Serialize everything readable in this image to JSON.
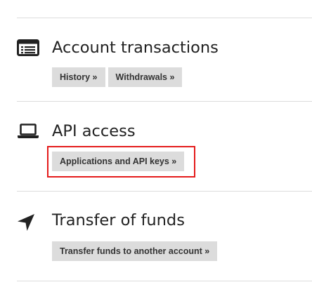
{
  "sections": [
    {
      "title": "Account transactions",
      "icon": "list-icon",
      "buttons": [
        "History »",
        "Withdrawals »"
      ]
    },
    {
      "title": "API access",
      "icon": "laptop-icon",
      "buttons": [
        "Applications and API keys »"
      ],
      "highlighted": true
    },
    {
      "title": "Transfer of funds",
      "icon": "location-arrow-icon",
      "buttons": [
        "Transfer funds to another account »"
      ]
    }
  ],
  "colors": {
    "highlight": "#e41b1b",
    "button_bg": "#dcdcdc",
    "divider": "#dcdcdc",
    "text": "#222222"
  }
}
